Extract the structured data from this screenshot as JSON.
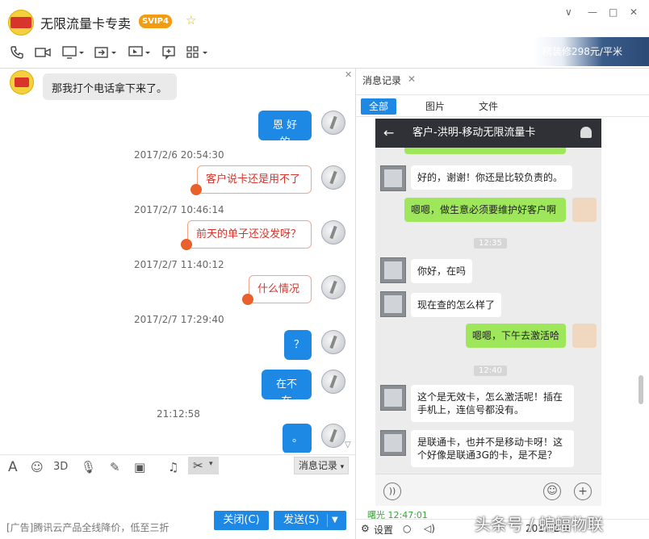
{
  "window": {
    "title": "无限流量卡专卖",
    "vip_badge": "SVIP4",
    "controls": [
      "∨",
      "—",
      "□",
      "✕"
    ]
  },
  "ad_banner": {
    "text": "精装修298元/平米"
  },
  "toolbar": {
    "icons": [
      "phone-icon",
      "video-icon",
      "screen-share-icon",
      "file-transfer-icon",
      "remote-desktop-icon",
      "comment-icon",
      "apps-icon"
    ]
  },
  "chat": {
    "messages": [
      {
        "type": "in",
        "text": "那我打个电话拿下来了。"
      },
      {
        "type": "out",
        "text": "恩 好的"
      },
      {
        "type": "time",
        "text": "2017/2/6 20:54:30"
      },
      {
        "type": "out-red",
        "text": "客户说卡还是用不了"
      },
      {
        "type": "time",
        "text": "2017/2/7 10:46:14"
      },
      {
        "type": "out-red",
        "text": "前天的单子还没发呀？"
      },
      {
        "type": "time",
        "text": "2017/2/7 11:40:12"
      },
      {
        "type": "out-red",
        "text": "什么情况"
      },
      {
        "type": "time",
        "text": "2017/2/7 17:29:40"
      },
      {
        "type": "out",
        "text": "？"
      },
      {
        "type": "out",
        "text": "在不在"
      },
      {
        "type": "time",
        "text": "21:12:58"
      },
      {
        "type": "out",
        "text": "。"
      }
    ]
  },
  "input_toolbar": {
    "font_label": "A",
    "record_button": "消息记录"
  },
  "footer": {
    "ad_text": "[广告]腾讯云产品全线降价，低至三折",
    "close_button": "关闭(C)",
    "send_button": "发送(S)"
  },
  "panel": {
    "tab_label": "消息记录",
    "filters": [
      "全部",
      "图片",
      "文件"
    ],
    "phone": {
      "title": "客户-洪明-移动无限流量卡",
      "messages": [
        {
          "side": "in",
          "text": "好的，谢谢！你还是比较负责的。"
        },
        {
          "side": "out",
          "text": "嗯嗯，做生意必须要维护好客户啊"
        },
        {
          "side": "time",
          "text": "12:35"
        },
        {
          "side": "in",
          "text": "你好，在吗"
        },
        {
          "side": "in",
          "text": "现在查的怎么样了"
        },
        {
          "side": "out",
          "text": "嗯嗯，下午去激活哈"
        },
        {
          "side": "time",
          "text": "12:40"
        },
        {
          "side": "in",
          "text": "这个是无效卡，怎么激活呢！插在手机上，连信号都没有。"
        },
        {
          "side": "in",
          "text": "是联通卡，也并不是移动卡呀！这个好像是联通3G的卡，是不是？"
        }
      ]
    },
    "partial_timestamp": "曙光 12:47:01",
    "bottom": {
      "settings": "设置",
      "date": "2017-2-9"
    }
  },
  "watermark": "头条号 / 蝙蝠物联"
}
